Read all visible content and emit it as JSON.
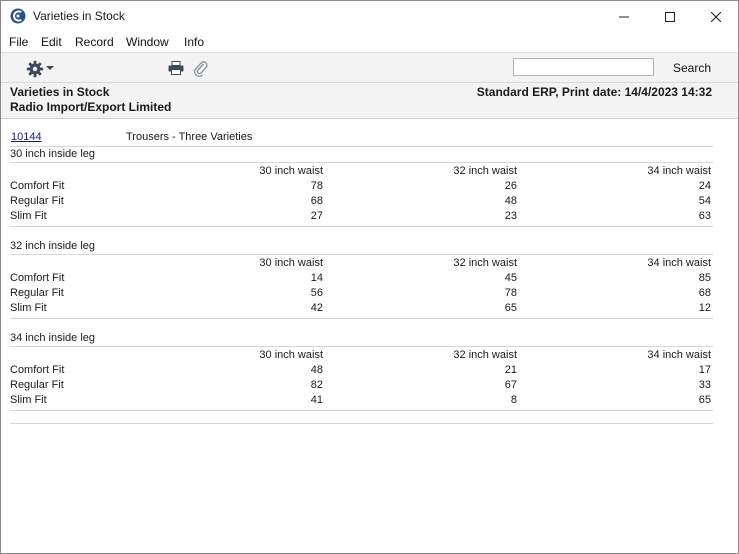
{
  "window": {
    "title": "Varieties in Stock"
  },
  "menu": [
    "File",
    "Edit",
    "Record",
    "Window",
    "Info"
  ],
  "toolbar": {
    "search_placeholder": "",
    "search_value": "",
    "search_label": "Search"
  },
  "report_header": {
    "title": "Varieties in Stock",
    "company": "Radio Import/Export Limited",
    "info": "Standard ERP, Print date: 14/4/2023 14:32"
  },
  "item": {
    "code": "10144",
    "description": "Trousers - Three Varieties"
  },
  "columns": [
    "30 inch waist",
    "32 inch waist",
    "34 inch waist"
  ],
  "sections": [
    {
      "title": "30 inch inside leg",
      "rows": [
        {
          "label": "Comfort Fit",
          "values": [
            "78",
            "26",
            "24"
          ]
        },
        {
          "label": "Regular Fit",
          "values": [
            "68",
            "48",
            "54"
          ]
        },
        {
          "label": "Slim Fit",
          "values": [
            "27",
            "23",
            "63"
          ]
        }
      ]
    },
    {
      "title": "32 inch inside leg",
      "rows": [
        {
          "label": "Comfort Fit",
          "values": [
            "14",
            "45",
            "85"
          ]
        },
        {
          "label": "Regular Fit",
          "values": [
            "56",
            "78",
            "68"
          ]
        },
        {
          "label": "Slim Fit",
          "values": [
            "42",
            "65",
            "12"
          ]
        }
      ]
    },
    {
      "title": "34 inch inside leg",
      "rows": [
        {
          "label": "Comfort Fit",
          "values": [
            "48",
            "21",
            "17"
          ]
        },
        {
          "label": "Regular Fit",
          "values": [
            "82",
            "67",
            "33"
          ]
        },
        {
          "label": "Slim Fit",
          "values": [
            "41",
            "8",
            "65"
          ]
        }
      ]
    }
  ]
}
